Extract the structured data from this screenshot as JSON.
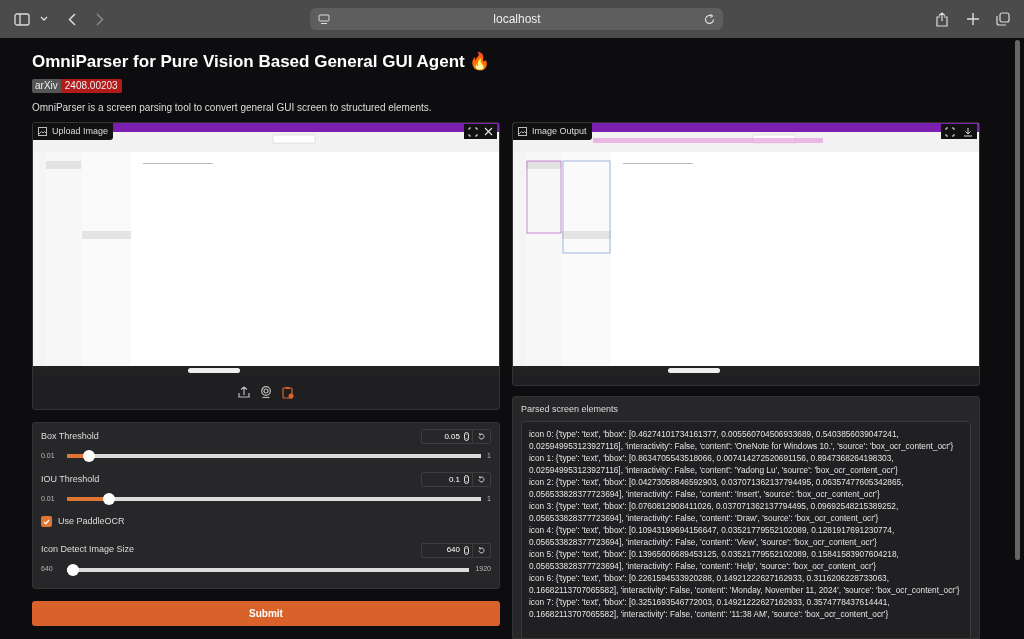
{
  "browser": {
    "address": "localhost"
  },
  "title": "OmniParser for Pure Vision Based General GUI Agent 🔥",
  "badge": {
    "label": "arXiv",
    "value": "2408.00203"
  },
  "description": "OmniParser is a screen parsing tool to convert general GUI screen to structured elements.",
  "upload_panel": {
    "label": "Upload Image"
  },
  "output_panel": {
    "label": "Image Output"
  },
  "controls": [
    {
      "kind": "slider",
      "label": "Box Threshold",
      "value": "0.05",
      "min": "0.01",
      "max": "1",
      "level": 0.04
    },
    {
      "kind": "slider",
      "label": "IOU Threshold",
      "value": "0.1",
      "min": "0.01",
      "max": "1",
      "level": 0.09
    },
    {
      "kind": "checkbox",
      "label": "Use PaddleOCR",
      "checked": true
    },
    {
      "kind": "slider",
      "label": "Icon Detect Image Size",
      "value": "640",
      "min": "640",
      "max": "1920",
      "level": 0
    }
  ],
  "submit": "Submit",
  "parsed": {
    "label": "Parsed screen elements",
    "lines": [
      "icon 0: {'type': 'text', 'bbox': [0.46274101734161377, 0.005560704506933689, 0.5403856039047241, 0.025949953123927116], 'interactivity': False, 'content': 'OneNote for Windows 10.', 'source': 'box_ocr_content_ocr'}",
      "icon 1: {'type': 'text', 'bbox': [0.8634705543518066, 0.007414272520691156, 0.8947368264198303, 0.025949953123927116], 'interactivity': False, 'content': 'Yadong Lu', 'source': 'box_ocr_content_ocr'}",
      "icon 2: {'type': 'text', 'bbox': [0.04273058846592903, 0.037071362137794495, 0.06357477605342865, 0.056533828377723694], 'interactivity': False, 'content': 'Insert', 'source': 'box_ocr_content_ocr'}",
      "icon 3: {'type': 'text', 'bbox': [0.0760812908411026, 0.037071362137794495, 0.09692548215389252, 0.056533828377723694], 'interactivity': False, 'content': 'Draw', 'source': 'box_ocr_content_ocr'}",
      "icon 4: {'type': 'text', 'bbox': [0.10943199694156647, 0.03521779552102089, 0.1281917691230774, 0.056533828377723694], 'interactivity': False, 'content': 'View', 'source': 'box_ocr_content_ocr'}",
      "icon 5: {'type': 'text', 'bbox': [0.13965606689453125, 0.03521779552102089, 0.15841583907604218, 0.056533828377723694], 'interactivity': False, 'content': 'Help', 'source': 'box_ocr_content_ocr'}",
      "icon 6: {'type': 'text', 'bbox': [0.2261594533920288, 0.14921222627162933, 0.3116206228733063, 0.16682113707065582], 'interactivity': False, 'content': 'Monday, November 11, 2024', 'source': 'box_ocr_content_ocr'}",
      "icon 7: {'type': 'text', 'bbox': [0.3251693546772003, 0.14921222627162933, 0.3574778437614441, 0.16682113707065582], 'interactivity': False, 'content': '11:38 AM', 'source': 'box_ocr_content_ocr'}"
    ]
  }
}
